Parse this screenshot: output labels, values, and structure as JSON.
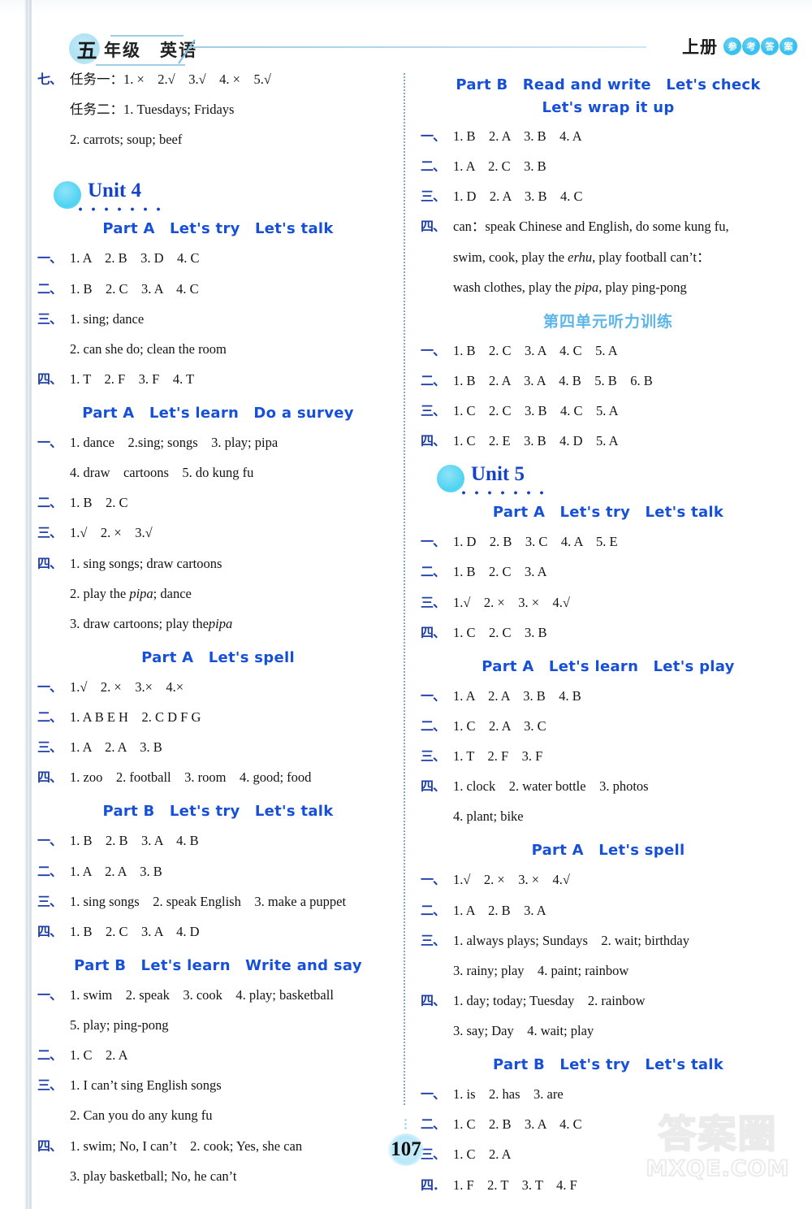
{
  "header": {
    "grade_char": "五",
    "grade_text": "年级　英语",
    "volume": "上册",
    "badges": [
      "参",
      "考",
      "答",
      "案"
    ]
  },
  "page_number": "107",
  "watermark": {
    "cn": "答案圈",
    "en": "MXQE.COM"
  },
  "left_column": {
    "blocks": [
      {
        "rows": [
          {
            "num": "七、",
            "ans": "任务一：1. ×　2.√　3.√　4. ×　5.√"
          },
          {
            "cont": "任务二：1. Tuesdays; Fridays"
          },
          {
            "cont": "2. carrots; soup; beef"
          }
        ]
      },
      {
        "unit": "Unit 4",
        "part": "Part A　Let's try　Let's talk",
        "rows": [
          {
            "num": "一、",
            "ans": "1. A　2. B　3. D　4. C"
          },
          {
            "num": "二、",
            "ans": "1. B　2. C　3. A　4. C"
          },
          {
            "num": "三、",
            "ans": "1. sing; dance"
          },
          {
            "cont": "2. can she do; clean the room"
          },
          {
            "num": "四、",
            "ans": "1. T　2. F　3. F　4. T"
          }
        ]
      },
      {
        "part": "Part A　Let's learn　Do a survey",
        "rows": [
          {
            "num": "一、",
            "ans": "1. dance　2.sing; songs　3. play; pipa"
          },
          {
            "cont": "4. draw　cartoons　5. do kung fu"
          },
          {
            "num": "二、",
            "ans": "1. B　2. C"
          },
          {
            "num": "三、",
            "ans": "1.√　2. ×　3.√"
          },
          {
            "num": "四、",
            "ans": "1. sing songs; draw cartoons"
          },
          {
            "cont": "2. play the {pipa}; dance"
          },
          {
            "cont": "3. draw cartoons; play the{pipa}"
          }
        ]
      },
      {
        "part": "Part A　Let's spell",
        "rows": [
          {
            "num": "一、",
            "ans": "1.√　2. ×　3.×　4.×"
          },
          {
            "num": "二、",
            "ans": "1. A B E H　2. C D F G"
          },
          {
            "num": "三、",
            "ans": "1. A　2. A　3. B"
          },
          {
            "num": "四、",
            "ans": "1. zoo　2. football　3. room　4. good; food"
          }
        ]
      },
      {
        "part": "Part B　Let's try　Let's talk",
        "rows": [
          {
            "num": "一、",
            "ans": "1. B　2. B　3. A　4. B"
          },
          {
            "num": "二、",
            "ans": "1. A　2. A　3. B"
          },
          {
            "num": "三、",
            "ans": "1. sing songs　2. speak English　3. make a puppet"
          },
          {
            "num": "四、",
            "ans": "1. B　2. C　3. A　4. D"
          }
        ]
      },
      {
        "part": "Part B　Let's learn　Write and say",
        "rows": [
          {
            "num": "一、",
            "ans": "1. swim　2. speak　3. cook　4. play; basketball"
          },
          {
            "cont": "5. play; ping-pong"
          },
          {
            "num": "二、",
            "ans": "1. C　2. A"
          },
          {
            "num": "三、",
            "ans": "1. I can’t sing English songs"
          },
          {
            "cont": "2. Can you do any kung fu"
          },
          {
            "num": "四、",
            "ans": "1. swim; No, I can’t　2. cook; Yes, she can"
          },
          {
            "cont": "3. play basketball; No, he can’t"
          }
        ]
      }
    ]
  },
  "right_column": {
    "blocks": [
      {
        "part": "Part B　Read and write　Let's check",
        "part_sub": "Let's wrap it up",
        "rows": [
          {
            "num": "一、",
            "ans": "1. B　2. A　3. B　4. A"
          },
          {
            "num": "二、",
            "ans": "1. A　2. C　3. B"
          },
          {
            "num": "三、",
            "ans": "1. D　2. A　3. B　4. C"
          },
          {
            "num": "四、",
            "ans": "can：speak Chinese and English, do some kung fu,"
          },
          {
            "cont": "swim, cook, play the {erhu}, play football can’t："
          },
          {
            "cont": "wash clothes, play the {pipa}, play ping-pong"
          }
        ]
      },
      {
        "cn_head": "第四单元听力训练",
        "rows": [
          {
            "num": "一、",
            "ans": "1. B　2. C　3. A　4. C　5. A"
          },
          {
            "num": "二、",
            "ans": "1. B　2. A　3. A　4. B　5. B　6. B"
          },
          {
            "num": "三、",
            "ans": "1. C　2. C　3. B　4. C　5. A"
          },
          {
            "num": "四、",
            "ans": "1. C　2. E　3. B　4. D　5. A"
          }
        ]
      },
      {
        "unit": "Unit 5",
        "part": "Part A　Let's try　Let's talk",
        "rows": [
          {
            "num": "一、",
            "ans": "1. D　2. B　3. C　4. A　5. E"
          },
          {
            "num": "二、",
            "ans": "1. B　2. C　3. A"
          },
          {
            "num": "三、",
            "ans": "1.√　2. ×　3. ×　4.√"
          },
          {
            "num": "四、",
            "ans": "1. C　2. C　3. B"
          }
        ]
      },
      {
        "part": "Part A　Let's learn　Let's play",
        "rows": [
          {
            "num": "一、",
            "ans": "1. A　2. A　3. B　4. B"
          },
          {
            "num": "二、",
            "ans": "1. C　2. A　3. C"
          },
          {
            "num": "三、",
            "ans": "1. T　2. F　3. F"
          },
          {
            "num": "四、",
            "ans": "1. clock　2. water bottle　3. photos"
          },
          {
            "cont": "4. plant; bike"
          }
        ]
      },
      {
        "part": "Part A　Let's spell",
        "rows": [
          {
            "num": "一、",
            "ans": "1.√　2. ×　3. ×　4.√"
          },
          {
            "num": "二、",
            "ans": "1. A　2. B　3. A"
          },
          {
            "num": "三、",
            "ans": "1. always plays; Sundays　2. wait; birthday"
          },
          {
            "cont": "3. rainy; play　4. paint; rainbow"
          },
          {
            "num": "四、",
            "ans": "1. day; today; Tuesday　2. rainbow"
          },
          {
            "cont": "3. say; Day　4. wait; play"
          }
        ]
      },
      {
        "part": "Part B　Let's try　Let's talk",
        "rows": [
          {
            "num": "一、",
            "ans": "1. is　2. has　3. are"
          },
          {
            "num": "二、",
            "ans": "1. C　2. B　3. A　4. C"
          },
          {
            "num": "三、",
            "ans": "1. C　2. A"
          },
          {
            "num": "四．",
            "ans": "1. F　2. T　3. T　4. F"
          }
        ]
      }
    ]
  }
}
